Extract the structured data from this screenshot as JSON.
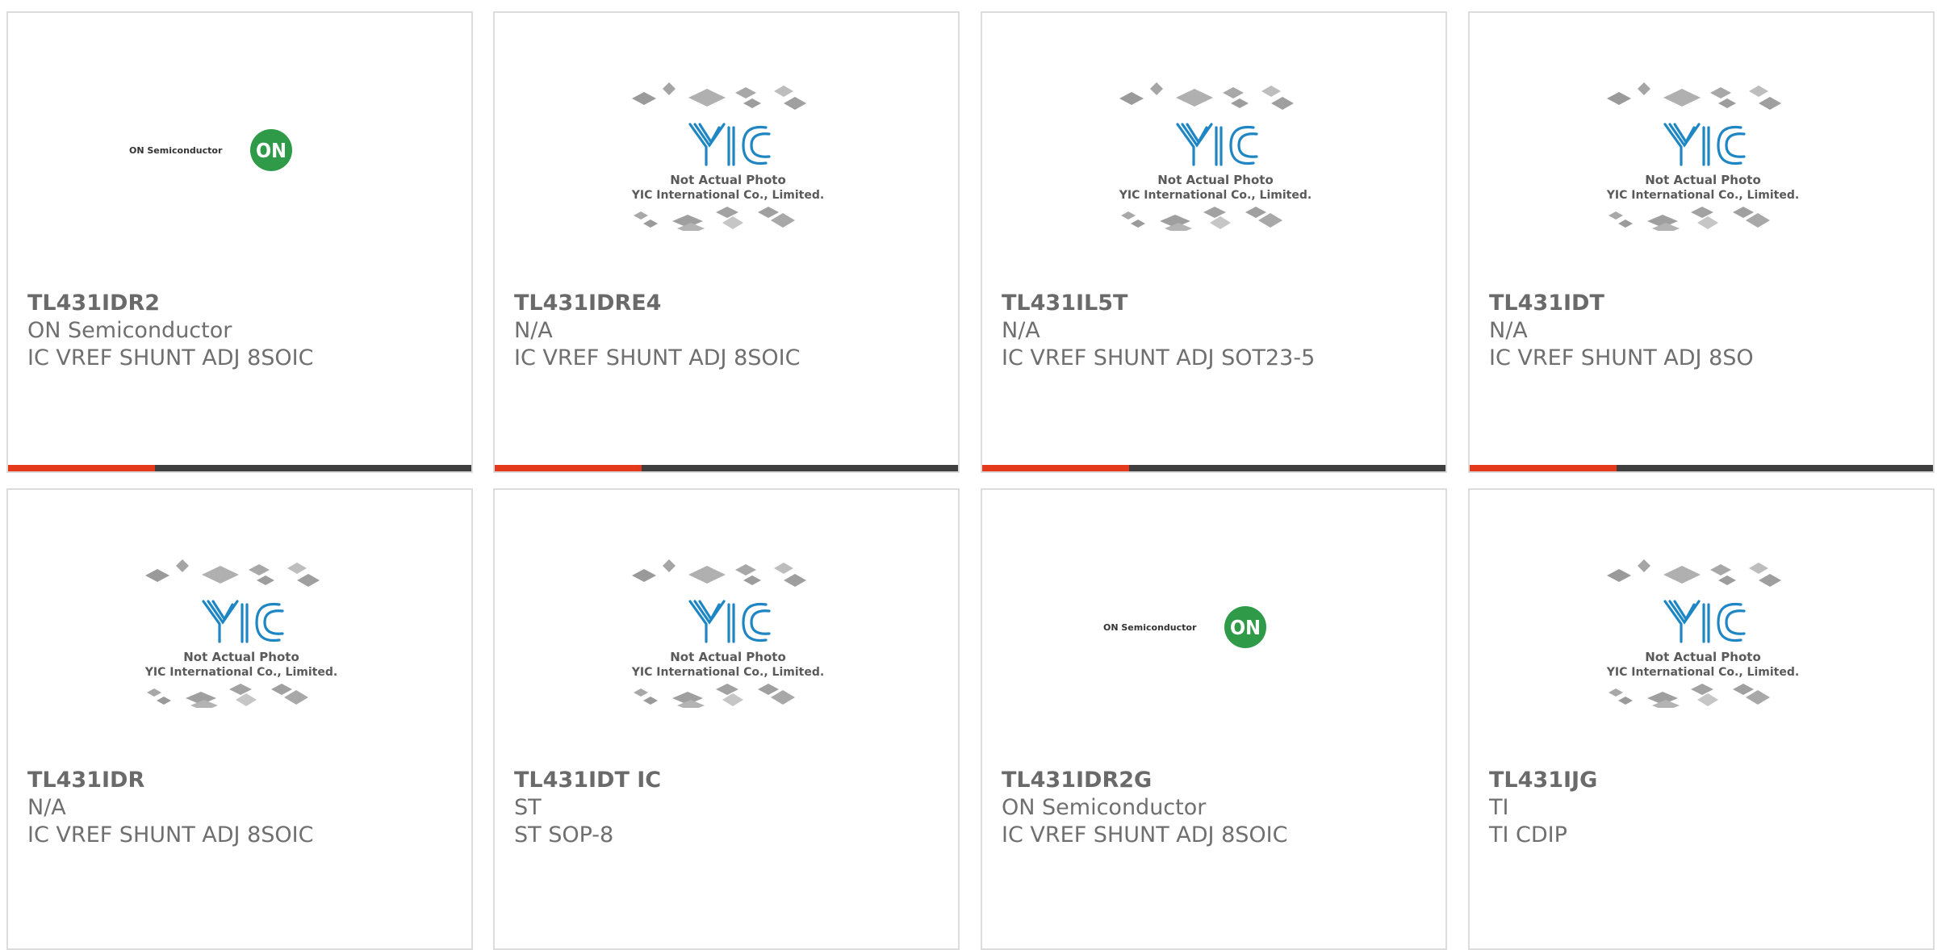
{
  "colors": {
    "accent": "#e5391b",
    "bar": "#3f3f3f",
    "border": "#dcdcdc",
    "text": "#6f6f6f",
    "yic_blue": "#1f86c4",
    "on_green": "#2f9a48"
  },
  "products": [
    {
      "part": "TL431IDR2",
      "manufacturer": "ON Semiconductor",
      "description": "IC VREF SHUNT ADJ 8SOIC",
      "image": "on-semiconductor-logo",
      "logo_text": "ON Semiconductor",
      "logo_badge": "ON"
    },
    {
      "part": "TL431IDRE4",
      "manufacturer": "N/A",
      "description": "IC VREF SHUNT ADJ 8SOIC",
      "image": "yic-placeholder",
      "caption1": "Not Actual Photo",
      "caption2": "YIC International Co., Limited."
    },
    {
      "part": "TL431IL5T",
      "manufacturer": "N/A",
      "description": "IC VREF SHUNT ADJ SOT23-5",
      "image": "yic-placeholder",
      "caption1": "Not Actual Photo",
      "caption2": "YIC International Co., Limited."
    },
    {
      "part": "TL431IDT",
      "manufacturer": "N/A",
      "description": "IC VREF SHUNT ADJ 8SO",
      "image": "yic-placeholder",
      "caption1": "Not Actual Photo",
      "caption2": "YIC International Co., Limited."
    },
    {
      "part": "TL431IDR",
      "manufacturer": "N/A",
      "description": "IC VREF SHUNT ADJ 8SOIC",
      "image": "yic-placeholder",
      "caption1": "Not Actual Photo",
      "caption2": "YIC International Co., Limited."
    },
    {
      "part": "TL431IDT IC",
      "manufacturer": "ST",
      "description": "ST SOP-8",
      "image": "yic-placeholder",
      "caption1": "Not Actual Photo",
      "caption2": "YIC International Co., Limited."
    },
    {
      "part": "TL431IDR2G",
      "manufacturer": "ON Semiconductor",
      "description": "IC VREF SHUNT ADJ 8SOIC",
      "image": "on-semiconductor-logo",
      "logo_text": "ON Semiconductor",
      "logo_badge": "ON"
    },
    {
      "part": "TL431IJG",
      "manufacturer": "TI",
      "description": "TI CDIP",
      "image": "yic-placeholder",
      "caption1": "Not Actual Photo",
      "caption2": "YIC International Co., Limited."
    }
  ]
}
